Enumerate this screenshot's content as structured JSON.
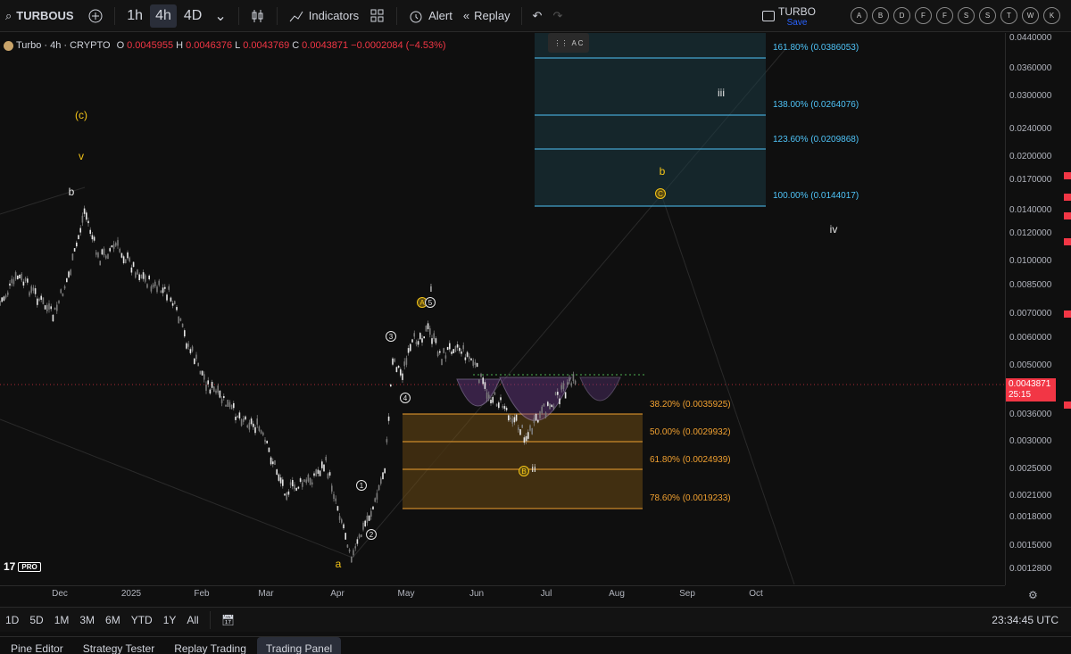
{
  "toolbar": {
    "symbol": "TURBOUS",
    "intervals": [
      "1h",
      "4h",
      "4D"
    ],
    "active_interval": "4h",
    "indicators": "Indicators",
    "alert": "Alert",
    "replay": "Replay",
    "layout_name": "TURBO",
    "save": "Save",
    "watch_circles": [
      "A",
      "B",
      "D",
      "F",
      "F",
      "S",
      "S",
      "T",
      "W",
      "K"
    ]
  },
  "legend": {
    "title": "Turbo · 4h · CRYPTO",
    "o_label": "O",
    "o": "0.0045955",
    "h_label": "H",
    "h": "0.0046376",
    "l_label": "L",
    "l": "0.0043769",
    "c_label": "C",
    "c": "0.0043871",
    "change": "−0.0002084 (−4.53%)"
  },
  "price_axis": [
    "0.0440000",
    "0.0360000",
    "0.0300000",
    "0.0240000",
    "0.0200000",
    "0.0170000",
    "0.0140000",
    "0.0120000",
    "0.0100000",
    "0.0085000",
    "0.0070000",
    "0.0060000",
    "0.0050000",
    "0.0036000",
    "0.0030000",
    "0.0025000",
    "0.0021000",
    "0.0018000",
    "0.0015000",
    "0.0012800"
  ],
  "current_price": {
    "value": "0.0043871",
    "countdown": "25:15"
  },
  "time_axis": [
    "Dec",
    "2025",
    "Feb",
    "Mar",
    "Apr",
    "May",
    "Jun",
    "Jul",
    "Aug",
    "Sep",
    "Oct"
  ],
  "fib_upper": [
    "161.80% (0.0386053)",
    "138.00% (0.0264076)",
    "123.60% (0.0209868)",
    "100.00% (0.0144017)"
  ],
  "fib_lower": [
    "38.20% (0.0035925)",
    "50.00% (0.0029932)",
    "61.80% (0.0024939)",
    "78.60% (0.0019233)"
  ],
  "wave_labels": {
    "c_paren": "(c)",
    "v": "v",
    "b_left": "b",
    "a": "a",
    "i": "i",
    "ii": "ii",
    "iii": "iii",
    "iv": "iv",
    "b_right": "b",
    "w1": "1",
    "w2": "2",
    "w3": "3",
    "w4": "4",
    "w5": "5",
    "A": "A",
    "B": "B",
    "C": "C"
  },
  "tools": {
    "float": "A C"
  },
  "logo": {
    "brand": "17",
    "pro": "PRO"
  },
  "ranges": [
    "1D",
    "5D",
    "1M",
    "3M",
    "6M",
    "YTD",
    "1Y",
    "All"
  ],
  "clock": "23:34:45 UTC",
  "tabs": [
    "Pine Editor",
    "Strategy Tester",
    "Replay Trading",
    "Trading Panel"
  ],
  "active_tab": "Trading Panel",
  "colors": {
    "up": "#d9d9d9",
    "down": "#d9d9d9",
    "accent": "#f23645",
    "fib_blue": "#4fc3f7",
    "fib_orange": "#f0a030"
  }
}
